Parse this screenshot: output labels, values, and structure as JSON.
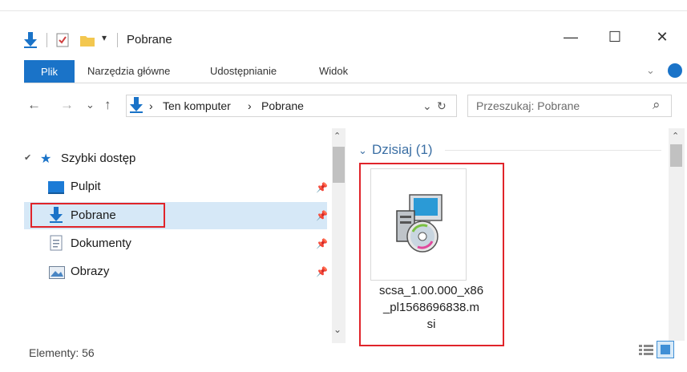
{
  "window": {
    "title": "Pobrane",
    "minimize_glyph": "—",
    "maximize_glyph": "☐",
    "close_glyph": "✕"
  },
  "ribbon": {
    "tabs": [
      "Plik",
      "Narzędzia główne",
      "Udostępnianie",
      "Widok"
    ],
    "expand_glyph": "⌄"
  },
  "address": {
    "back_glyph": "←",
    "forward_glyph": "→",
    "recent_glyph": "⌄",
    "up_glyph": "↑",
    "path": [
      "Ten komputer",
      "Pobrane"
    ],
    "separator": "›",
    "dropdown_glyph": "⌄",
    "refresh_glyph": "↻"
  },
  "search": {
    "placeholder": "Przeszukaj: Pobrane",
    "icon_glyph": "⌕"
  },
  "nav_pane": {
    "quick_access": "Szybki dostęp",
    "items": [
      {
        "label": "Pulpit",
        "icon": "desktop-icon"
      },
      {
        "label": "Pobrane",
        "icon": "download-icon"
      },
      {
        "label": "Dokumenty",
        "icon": "document-icon"
      },
      {
        "label": "Obrazy",
        "icon": "pictures-icon"
      }
    ],
    "pin_glyph": "📌"
  },
  "content": {
    "group_header": "Dzisiaj (1)",
    "file": {
      "name_lines": [
        "scsa_1.00.000_x86",
        "_pl1568696838.m",
        "si"
      ],
      "icon": "msi-installer-icon"
    }
  },
  "status_bar": {
    "text": "Elementy: 56"
  },
  "colors": {
    "accent": "#1a73c8",
    "highlight": "#e0242a",
    "selection": "#d6e8f7",
    "group_header": "#3b6fa4"
  }
}
